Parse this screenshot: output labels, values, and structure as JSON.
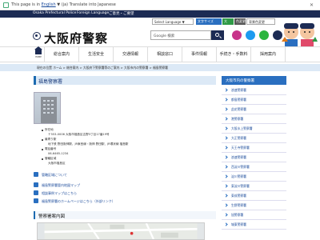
{
  "translate_bar": {
    "prefix": "This page is in",
    "source_lang": "English",
    "dropdown_arrow": "▼",
    "suffix": "(ja) Translate into Japanese",
    "close": "✕"
  },
  "navbar": {
    "site_en": "Osaka Prefectural Police",
    "lang_link": "Foreign Language",
    "opinion": "ご意見・ご要望"
  },
  "header": {
    "title": "大阪府警察",
    "select_language": "Select Language ▼",
    "btn_japanese": "文字サイズ",
    "btn_large": "大",
    "btn_color": "色変更",
    "btn_access": "背景色変更",
    "search_placeholder": "Google 検索",
    "colors": {
      "navy": "#1c2b54",
      "blue": "#2a6fc0",
      "green": "#2f9a46",
      "orange": "#e07a1a"
    }
  },
  "mainnav": {
    "home_label": "HOME",
    "items": [
      "総合案内",
      "生活安全",
      "交通情報",
      "相談窓口",
      "事件情報",
      "手続き・手数料",
      "採用案内"
    ]
  },
  "breadcrumb": "現在の位置  ホーム > 総合案内 > 大阪府下警察署等のご案内 > 大阪市内の警察署 > 福島警察署",
  "page_title": "福島警察署",
  "info": [
    "所在地",
    "〒553-0006 大阪市福島区吉野3丁目17番19号",
    "最寄り駅",
    "地下鉄 野田阪神駅、JR東西線・阪神 野田駅、JR環状線 福島駅",
    "電話番号",
    "06-6465-1234",
    "管轄区域",
    "大阪市福島区"
  ],
  "links": [
    "管轄区域について",
    "福島警察署管内地図マップ",
    "相談事例マップはこちら",
    "福島警察署のホームページはこちら（外部リンク）"
  ],
  "section_title": "警察署案内図",
  "sidebar": {
    "title": "大阪市内の警察署",
    "items": [
      "浪速警察署",
      "都島警察署",
      "此花警察署",
      "港警察署",
      "大阪水上警察署",
      "大正警察署",
      "天王寺警察署",
      "浪速警察署",
      "西淀川警察署",
      "淀川警察署",
      "東淀川警察署",
      "東成警察署",
      "生野警察署",
      "旭警察署",
      "城東警察署"
    ]
  }
}
